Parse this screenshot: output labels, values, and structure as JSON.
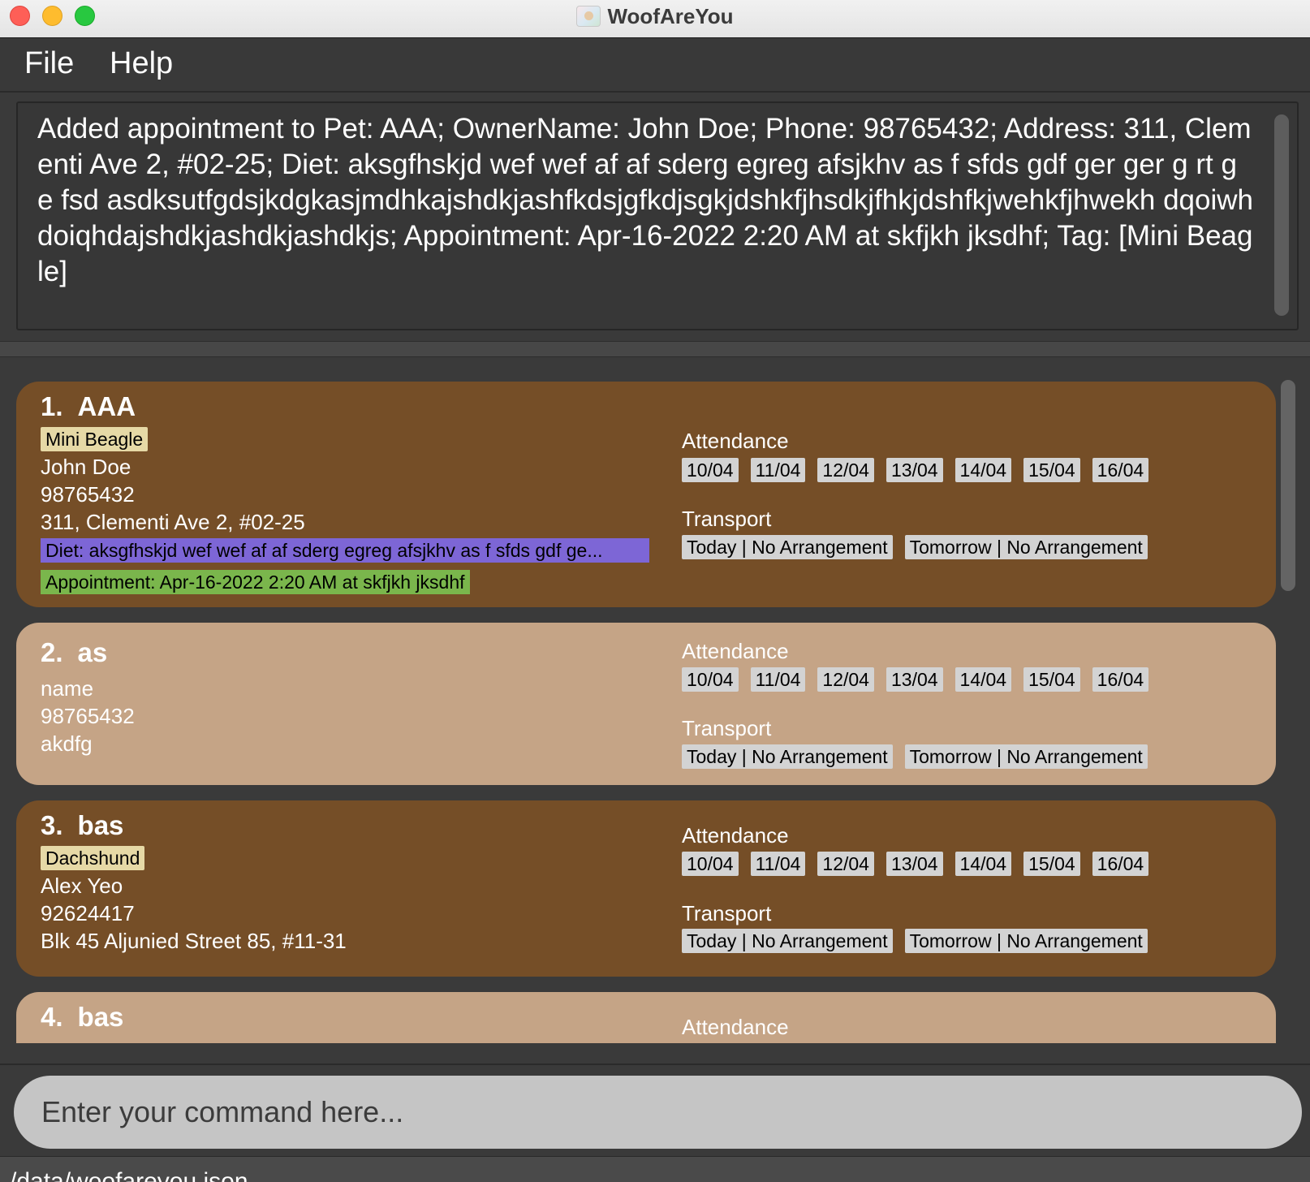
{
  "window": {
    "title": "WoofAreYou"
  },
  "menu": {
    "file": "File",
    "help": "Help"
  },
  "result_message": "Added appointment to Pet: AAA; OwnerName: John Doe; Phone: 98765432; Address: 311, Clementi Ave 2, #02-25; Diet: aksgfhskjd wef wef af af sderg egreg afsjkhv as f sfds gdf ger ger g rt g e fsd asdksutfgdsjkdgkasjmdhkajshdkjashfkdsjgfkdjsgkjdshkfjhsdkjfhkjdshfkjwehkfjhwekh dqoiwhdoiqhdajshdkjashdkjashdkjs; Appointment: Apr-16-2022 2:20 AM at skfjkh jksdhf; Tag: [Mini Beagle]",
  "labels": {
    "attendance": "Attendance",
    "transport": "Transport"
  },
  "dates": [
    "10/04",
    "11/04",
    "12/04",
    "13/04",
    "14/04",
    "15/04",
    "16/04"
  ],
  "transport_options": [
    "Today | No Arrangement",
    "Tomorrow | No Arrangement"
  ],
  "pets": [
    {
      "index": "1.",
      "name": "AAA",
      "tag": "Mini Beagle",
      "owner": "John Doe",
      "phone": "98765432",
      "address": "311, Clementi Ave 2, #02-25",
      "diet": "Diet: aksgfhskjd wef wef af af sderg egreg afsjkhv as f sfds gdf ge...",
      "appointment": "Appointment: Apr-16-2022 2:20 AM at skfjkh jksdhf"
    },
    {
      "index": "2.",
      "name": "as",
      "owner": "name",
      "phone": "98765432",
      "address": "akdfg"
    },
    {
      "index": "3.",
      "name": "bas",
      "tag": "Dachshund",
      "owner": "Alex Yeo",
      "phone": "92624417",
      "address": "Blk 45 Aljunied Street 85, #11-31"
    },
    {
      "index": "4.",
      "name": "bas"
    }
  ],
  "command": {
    "placeholder": "Enter your command here..."
  },
  "status": {
    "path": "/data/woofareyou.json"
  },
  "colors": {
    "card_dark": "#754e27",
    "card_light": "#c5a486",
    "tag": "#e6d9a6",
    "diet": "#7d66d6",
    "appointment": "#7ab64c",
    "chip": "#d3d3d3"
  }
}
